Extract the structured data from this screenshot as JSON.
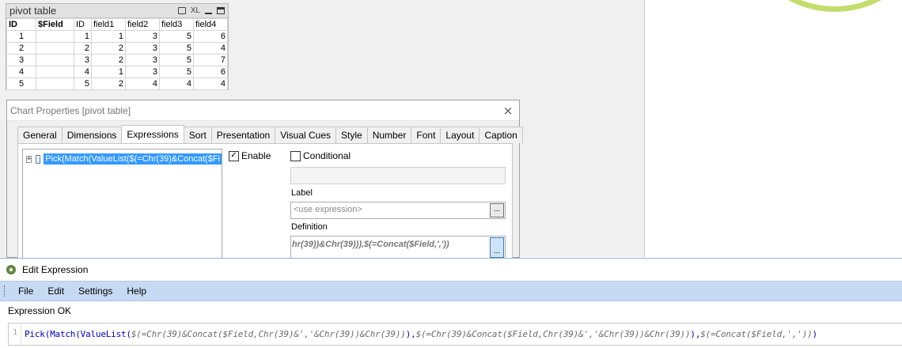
{
  "pivot": {
    "title": "pivot table",
    "xl_icon": "XL",
    "headers": [
      "ID",
      "$Field",
      "ID",
      "field1",
      "field2",
      "field3",
      "field4"
    ],
    "rows": [
      [
        "1",
        "",
        "1",
        "1",
        "3",
        "5",
        "6"
      ],
      [
        "2",
        "",
        "2",
        "2",
        "3",
        "5",
        "4"
      ],
      [
        "3",
        "",
        "3",
        "2",
        "3",
        "5",
        "7"
      ],
      [
        "4",
        "",
        "4",
        "1",
        "3",
        "5",
        "6"
      ],
      [
        "5",
        "",
        "5",
        "2",
        "4",
        "4",
        "4"
      ]
    ]
  },
  "dialog": {
    "title": "Chart Properties [pivot table]",
    "close": "×",
    "tabs": [
      "General",
      "Dimensions",
      "Expressions",
      "Sort",
      "Presentation",
      "Visual Cues",
      "Style",
      "Number",
      "Font",
      "Layout",
      "Caption"
    ],
    "active_tab": "Expressions",
    "tree_item": "Pick(Match(ValueList($(=Chr(39)&Concat($Fi",
    "enable_label": "Enable",
    "enable_checked": true,
    "conditional_label": "Conditional",
    "conditional_checked": false,
    "label_caption": "Label",
    "label_placeholder": "<use expression>",
    "definition_caption": "Definition",
    "definition_value": "hr(39))&Chr(39))),$(=Concat($Field,','))",
    "ellipsis": "..."
  },
  "edit_expression": {
    "title": "Edit Expression",
    "menu": [
      "File",
      "Edit",
      "Settings",
      "Help"
    ],
    "status": "Expression OK",
    "line_number": "1",
    "code_parts": [
      {
        "text": "Pick(Match(ValueList(",
        "kind": "fn"
      },
      {
        "text": "$(=Chr(39)&Concat($Field,Chr(39)&','&Chr(39))&Chr(39))",
        "kind": "dollar"
      },
      {
        "text": "),",
        "kind": "fn"
      },
      {
        "text": "$(=Chr(39)&Concat($Field,Chr(39)&','&Chr(39))&Chr(39))",
        "kind": "dollar"
      },
      {
        "text": "),",
        "kind": "fn"
      },
      {
        "text": "$(=Concat($Field,','))",
        "kind": "dollar"
      },
      {
        "text": ")",
        "kind": "fn"
      }
    ]
  },
  "colors": {
    "accent_green": "#c4dd6e",
    "selection_blue": "#3399ff",
    "menubar": "#c6daf4"
  }
}
